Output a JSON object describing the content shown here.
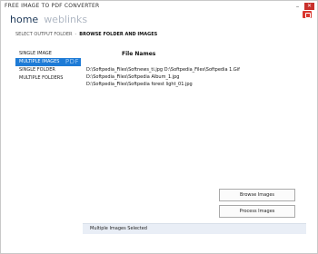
{
  "app": {
    "title": "FREE IMAGE TO PDF CONVERTER"
  },
  "nav": {
    "home": "home",
    "weblinks": "weblinks"
  },
  "breadcrumb": {
    "step1": "SELECT OUTPUT FOLDER",
    "separator": "-",
    "step2": "BROWSE FOLDER AND IMAGES"
  },
  "sidebar": {
    "items": [
      {
        "label": "SINGLE IMAGE"
      },
      {
        "label": "MULTIPLE IMAGES",
        "ghost": "PDF"
      },
      {
        "label": "SINGLE FOLDER"
      },
      {
        "label": "MULTIPLE FOLDERS"
      }
    ]
  },
  "table": {
    "header": "File Names"
  },
  "files": [
    "D:\\Softpedia_Files\\Softnews_ti.jpg D:\\Softpedia_Files\\Softpedia 1.Gif",
    "D:\\Softpedia_Files\\Softpedia Album_1.jpg",
    "D:\\Softpedia_Files\\Softpedia forest light_01.jpg"
  ],
  "buttons": {
    "browse": "Browse Images",
    "process": "Process Images"
  },
  "status": {
    "text": "Multiple Images Selected"
  },
  "colors": {
    "accent": "#1e7bd6",
    "close": "#c9302c",
    "status_bg": "#e9eef6"
  }
}
